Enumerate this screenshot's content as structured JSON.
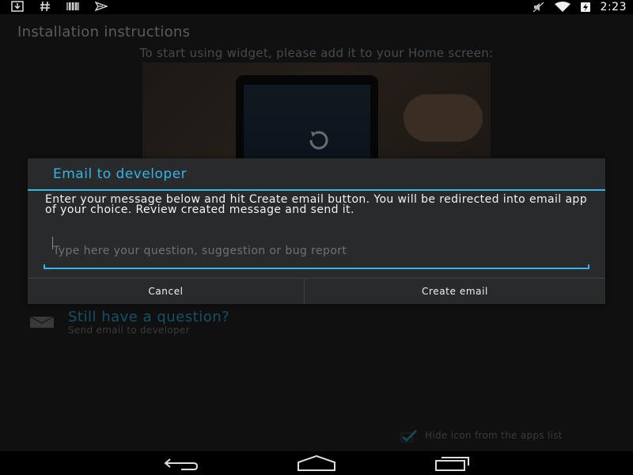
{
  "status_bar": {
    "time": "2:23",
    "left_icons": [
      "download-icon",
      "hash-icon",
      "barcode-icon",
      "send-icon"
    ],
    "right_icons": [
      "mute-icon",
      "wifi-icon",
      "battery-charging-icon"
    ]
  },
  "background": {
    "title": "Installation instructions",
    "subtitle": "To start using widget, please add it to your Home screen:",
    "question_title": "Still have a question?",
    "question_subtitle": "Send email to developer",
    "hide_icon_label": "Hide icon from the apps list",
    "hide_icon_checked": true
  },
  "dialog": {
    "title": "Email to developer",
    "message": "Enter your message below and hit Create email button. You will be redirected into email app of your choice. Review created message and send it.",
    "input_value": "",
    "input_placeholder": "Type here your question, suggestion or bug report",
    "cancel_label": "Cancel",
    "create_label": "Create email"
  },
  "nav_bar": {
    "icons": [
      "back-icon",
      "home-icon",
      "recent-apps-icon"
    ]
  },
  "colors": {
    "accent": "#33b5e5",
    "dialog_bg": "#282a2b",
    "link": "#1f7d9b"
  }
}
